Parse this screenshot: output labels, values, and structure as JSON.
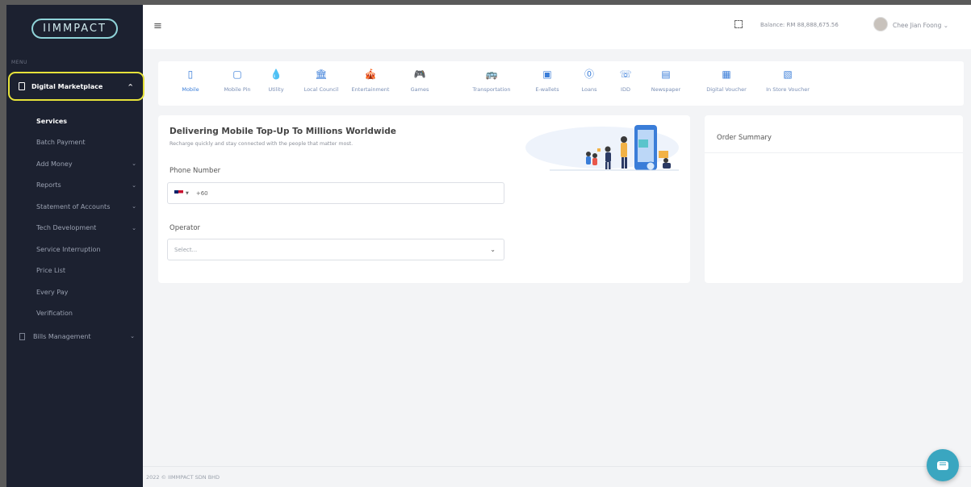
{
  "app": {
    "logo_text": "IIMMPACT"
  },
  "sidebar": {
    "menu_label": "MENU",
    "digital_marketplace": "Digital Marketplace",
    "items": [
      {
        "label": "Services",
        "active": true,
        "chevron": false
      },
      {
        "label": "Batch Payment",
        "active": false,
        "chevron": false
      },
      {
        "label": "Add Money",
        "active": false,
        "chevron": true
      },
      {
        "label": "Reports",
        "active": false,
        "chevron": true
      },
      {
        "label": "Statement of Accounts",
        "active": false,
        "chevron": true
      },
      {
        "label": "Tech Development",
        "active": false,
        "chevron": true
      },
      {
        "label": "Service Interruption",
        "active": false,
        "chevron": false
      },
      {
        "label": "Price List",
        "active": false,
        "chevron": false
      },
      {
        "label": "Every Pay",
        "active": false,
        "chevron": false
      },
      {
        "label": "Verification",
        "active": false,
        "chevron": false
      }
    ],
    "bills_management": "Bills Management"
  },
  "header": {
    "balance": "Balance: RM 88,888,675.56",
    "username": "Chee Jian Foong"
  },
  "categories": [
    {
      "label": "Mobile",
      "icon": "mobile-icon",
      "active": true
    },
    {
      "label": "Mobile Pin",
      "icon": "mobile-pin-icon",
      "active": false
    },
    {
      "label": "Utility",
      "icon": "utility-icon",
      "active": false
    },
    {
      "label": "Local Council",
      "icon": "local-council-icon",
      "active": false
    },
    {
      "label": "Entertainment",
      "icon": "entertainment-icon",
      "active": false
    },
    {
      "label": "Games",
      "icon": "games-icon",
      "active": false
    },
    {
      "label": "Transportation",
      "icon": "transportation-icon",
      "active": false
    },
    {
      "label": "E-wallets",
      "icon": "e-wallets-icon",
      "active": false
    },
    {
      "label": "Loans",
      "icon": "loans-icon",
      "active": false
    },
    {
      "label": "IDD",
      "icon": "idd-icon",
      "active": false
    },
    {
      "label": "Newspaper",
      "icon": "newspaper-icon",
      "active": false
    },
    {
      "label": "Digital Voucher",
      "icon": "digital-voucher-icon",
      "active": false
    },
    {
      "label": "In Store Voucher",
      "icon": "in-store-voucher-icon",
      "active": false
    }
  ],
  "form": {
    "title": "Delivering Mobile Top-Up To Millions Worldwide",
    "subtitle": "Recharge quickly and stay connected with the people that matter most.",
    "phone_label": "Phone Number",
    "phone_prefix": "+60",
    "operator_label": "Operator",
    "operator_placeholder": "Select..."
  },
  "summary": {
    "title": "Order Summary"
  },
  "footer": {
    "text": "2022 © IIMMPACT SDN BHD"
  },
  "colors": {
    "sidebar_bg": "#1c2130",
    "accent": "#3a7dd8",
    "highlight": "#e6e23a",
    "chat": "#3aa6c0"
  }
}
